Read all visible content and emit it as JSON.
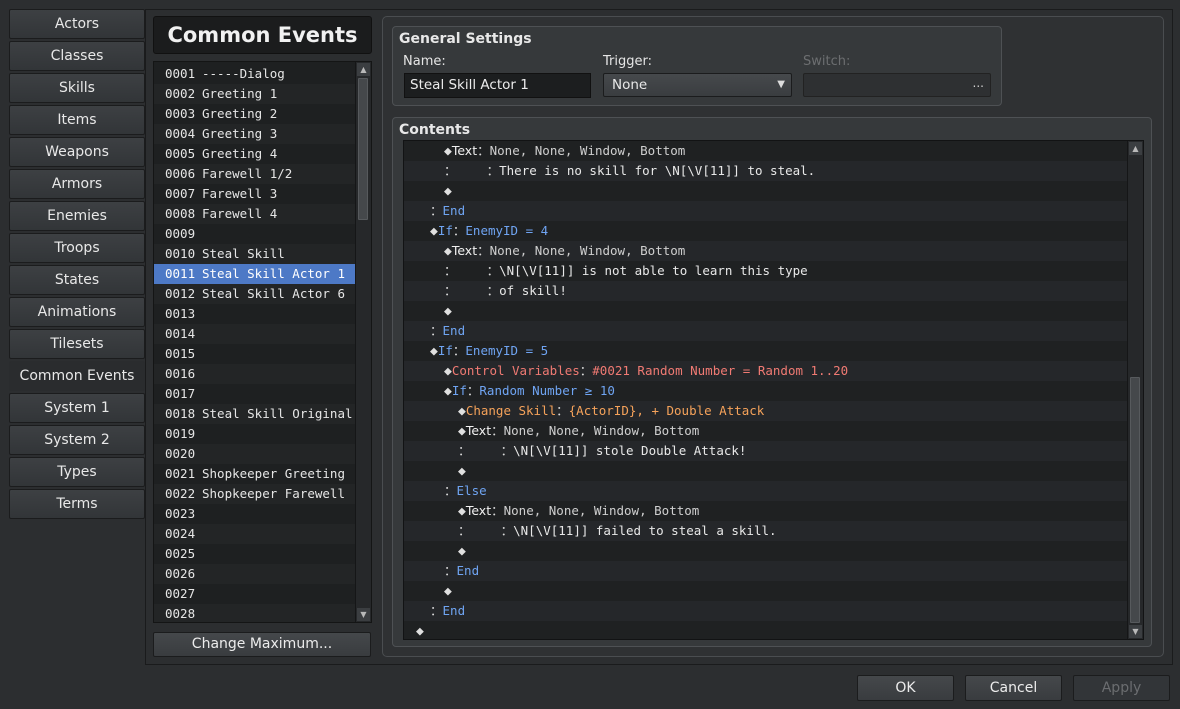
{
  "tabs": [
    {
      "label": "Actors"
    },
    {
      "label": "Classes"
    },
    {
      "label": "Skills"
    },
    {
      "label": "Items"
    },
    {
      "label": "Weapons"
    },
    {
      "label": "Armors"
    },
    {
      "label": "Enemies"
    },
    {
      "label": "Troops"
    },
    {
      "label": "States"
    },
    {
      "label": "Animations"
    },
    {
      "label": "Tilesets"
    },
    {
      "label": "Common Events",
      "active": true
    },
    {
      "label": "System 1"
    },
    {
      "label": "System 2"
    },
    {
      "label": "Types"
    },
    {
      "label": "Terms"
    }
  ],
  "common_events": {
    "title": "Common Events",
    "selected_id": "0011",
    "items": [
      {
        "id": "0001",
        "name": "-----Dialog"
      },
      {
        "id": "0002",
        "name": "Greeting 1"
      },
      {
        "id": "0003",
        "name": "Greeting 2"
      },
      {
        "id": "0004",
        "name": "Greeting 3"
      },
      {
        "id": "0005",
        "name": "Greeting 4"
      },
      {
        "id": "0006",
        "name": "Farewell 1/2"
      },
      {
        "id": "0007",
        "name": "Farewell 3"
      },
      {
        "id": "0008",
        "name": "Farewell 4"
      },
      {
        "id": "0009",
        "name": ""
      },
      {
        "id": "0010",
        "name": "Steal Skill"
      },
      {
        "id": "0011",
        "name": "Steal Skill Actor 1"
      },
      {
        "id": "0012",
        "name": "Steal Skill Actor 6"
      },
      {
        "id": "0013",
        "name": ""
      },
      {
        "id": "0014",
        "name": ""
      },
      {
        "id": "0015",
        "name": ""
      },
      {
        "id": "0016",
        "name": ""
      },
      {
        "id": "0017",
        "name": ""
      },
      {
        "id": "0018",
        "name": "Steal Skill Original"
      },
      {
        "id": "0019",
        "name": ""
      },
      {
        "id": "0020",
        "name": ""
      },
      {
        "id": "0021",
        "name": "Shopkeeper Greeting"
      },
      {
        "id": "0022",
        "name": "Shopkeeper Farewell"
      },
      {
        "id": "0023",
        "name": ""
      },
      {
        "id": "0024",
        "name": ""
      },
      {
        "id": "0025",
        "name": ""
      },
      {
        "id": "0026",
        "name": ""
      },
      {
        "id": "0027",
        "name": ""
      },
      {
        "id": "0028",
        "name": ""
      }
    ],
    "change_max_label": "Change Maximum..."
  },
  "general": {
    "title": "General Settings",
    "name_label": "Name:",
    "name_value": "Steal Skill Actor 1",
    "trigger_label": "Trigger:",
    "trigger_value": "None",
    "switch_label": "Switch:",
    "switch_button": "..."
  },
  "contents": {
    "title": "Contents",
    "commands": [
      {
        "indent": 2,
        "lead": "◆",
        "cmd": "Text",
        "cmd_class": "kw-text",
        "sep": "：",
        "args": "None, None, Window, Bottom",
        "args_class": "args"
      },
      {
        "indent": 2,
        "lead": "：",
        "cmd": "",
        "sep": "    ：",
        "args": "There is no skill for \\N[\\V[11]] to steal.",
        "args_class": "msg"
      },
      {
        "indent": 2,
        "lead": "◆",
        "cmd": "",
        "sep": "",
        "args": ""
      },
      {
        "indent": 1,
        "lead": "：",
        "cmd": "End",
        "cmd_class": "flow",
        "sep": "",
        "args": ""
      },
      {
        "indent": 1,
        "lead": "◆",
        "cmd": "If",
        "cmd_class": "flow",
        "sep": "：",
        "args": "EnemyID = 4",
        "args_class": "flow"
      },
      {
        "indent": 2,
        "lead": "◆",
        "cmd": "Text",
        "cmd_class": "kw-text",
        "sep": "：",
        "args": "None, None, Window, Bottom",
        "args_class": "args"
      },
      {
        "indent": 2,
        "lead": "：",
        "cmd": "",
        "sep": "    ：",
        "args": "\\N[\\V[11]] is not able to learn this type",
        "args_class": "msg"
      },
      {
        "indent": 2,
        "lead": "：",
        "cmd": "",
        "sep": "    ：",
        "args": "of skill!",
        "args_class": "msg"
      },
      {
        "indent": 2,
        "lead": "◆",
        "cmd": "",
        "sep": "",
        "args": ""
      },
      {
        "indent": 1,
        "lead": "：",
        "cmd": "End",
        "cmd_class": "flow",
        "sep": "",
        "args": ""
      },
      {
        "indent": 1,
        "lead": "◆",
        "cmd": "If",
        "cmd_class": "flow",
        "sep": "：",
        "args": "EnemyID = 5",
        "args_class": "flow"
      },
      {
        "indent": 2,
        "lead": "◆",
        "cmd": "Control Variables",
        "cmd_class": "ctrl",
        "sep": "：",
        "args": "#0021 Random Number = Random 1..20",
        "args_class": "ctrl"
      },
      {
        "indent": 2,
        "lead": "◆",
        "cmd": "If",
        "cmd_class": "flow",
        "sep": "：",
        "args": "Random Number ≥ 10",
        "args_class": "flow"
      },
      {
        "indent": 3,
        "lead": "◆",
        "cmd": "Change Skill",
        "cmd_class": "skill",
        "sep": "：",
        "args": "{ActorID}, + Double Attack",
        "args_class": "skill"
      },
      {
        "indent": 3,
        "lead": "◆",
        "cmd": "Text",
        "cmd_class": "kw-text",
        "sep": "：",
        "args": "None, None, Window, Bottom",
        "args_class": "args"
      },
      {
        "indent": 3,
        "lead": "：",
        "cmd": "",
        "sep": "    ：",
        "args": "\\N[\\V[11]] stole Double Attack!",
        "args_class": "msg"
      },
      {
        "indent": 3,
        "lead": "◆",
        "cmd": "",
        "sep": "",
        "args": ""
      },
      {
        "indent": 2,
        "lead": "：",
        "cmd": "Else",
        "cmd_class": "flow",
        "sep": "",
        "args": ""
      },
      {
        "indent": 3,
        "lead": "◆",
        "cmd": "Text",
        "cmd_class": "kw-text",
        "sep": "：",
        "args": "None, None, Window, Bottom",
        "args_class": "args"
      },
      {
        "indent": 3,
        "lead": "：",
        "cmd": "",
        "sep": "    ：",
        "args": "\\N[\\V[11]] failed to steal a skill.",
        "args_class": "msg"
      },
      {
        "indent": 3,
        "lead": "◆",
        "cmd": "",
        "sep": "",
        "args": ""
      },
      {
        "indent": 2,
        "lead": "：",
        "cmd": "End",
        "cmd_class": "flow",
        "sep": "",
        "args": ""
      },
      {
        "indent": 2,
        "lead": "◆",
        "cmd": "",
        "sep": "",
        "args": ""
      },
      {
        "indent": 1,
        "lead": "：",
        "cmd": "End",
        "cmd_class": "flow",
        "sep": "",
        "args": ""
      },
      {
        "indent": 0,
        "lead": "◆",
        "cmd": "",
        "sep": "",
        "args": ""
      }
    ]
  },
  "buttons": {
    "ok": "OK",
    "cancel": "Cancel",
    "apply": "Apply"
  }
}
